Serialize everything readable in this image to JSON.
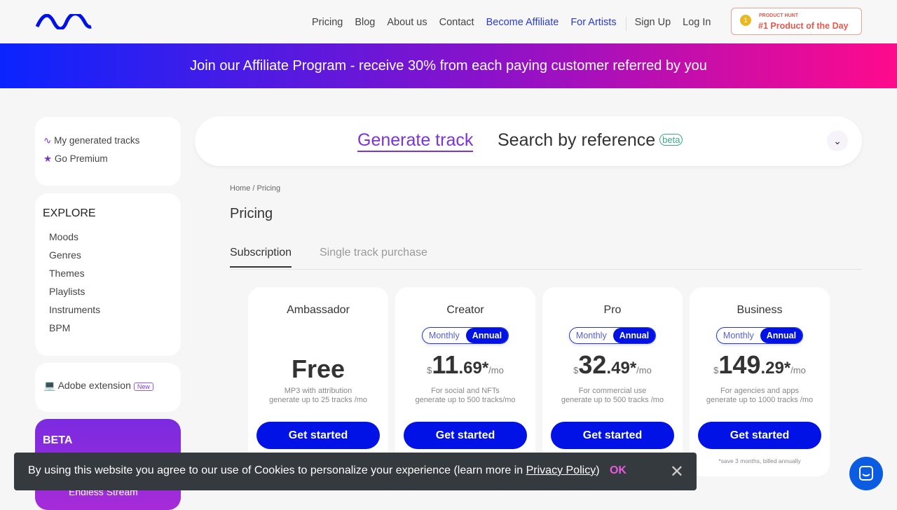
{
  "nav": {
    "items": [
      "Pricing",
      "Blog",
      "About us",
      "Contact",
      "Become Affiliate",
      "For Artists"
    ],
    "signup": "Sign Up",
    "login": "Log In",
    "producthunt": {
      "label": "PRODUCT HUNT",
      "title": "#1 Product of the Day",
      "medal": "1"
    }
  },
  "banner": "Join our Affiliate Program - receive 30% from each paying customer referred by you",
  "sidebar": {
    "quick": [
      "My generated tracks",
      "Go Premium"
    ],
    "explore_title": "EXPLORE",
    "explore": [
      "Moods",
      "Genres",
      "Themes",
      "Playlists",
      "Instruments",
      "BPM"
    ],
    "adobe": "Adobe extension",
    "new_badge": "New",
    "beta_title": "BETA",
    "endless": "Endless Stream"
  },
  "search": {
    "generate": "Generate track",
    "reference": "Search by reference",
    "beta": "beta"
  },
  "breadcrumb": {
    "home": "Home",
    "sep": "/",
    "current": "Pricing"
  },
  "title": "Pricing",
  "tabs": [
    "Subscription",
    "Single track purchase"
  ],
  "toggle": {
    "monthly": "Monthly",
    "annual": "Annual"
  },
  "plans": [
    {
      "name": "Ambassador",
      "price": "Free",
      "desc1": "MP3 with attribution",
      "desc2": "generate up to 25 tracks /mo",
      "cta": "Get started"
    },
    {
      "name": "Creator",
      "cur": "$",
      "int": "11",
      "cents": ".69*",
      "per": "/mo",
      "desc1": "For social and NFTs",
      "desc2": "generate up to 500 tracks/mo",
      "cta": "Get started"
    },
    {
      "name": "Pro",
      "cur": "$",
      "int": "32",
      "cents": ".49*",
      "per": "/mo",
      "desc1": "For commercial use",
      "desc2": "generate up to 500 tracks /mo",
      "cta": "Get started"
    },
    {
      "name": "Business",
      "cur": "$",
      "int": "149",
      "cents": ".29*",
      "per": "/mo",
      "desc1": "For agencies and apps",
      "desc2": "generate up to 1000 tracks /mo",
      "cta": "Get started",
      "note": "*save 3 months, billed annually"
    }
  ],
  "cookie": {
    "text": "By using this website you agree to our use of Cookies to personalize your experience (learn more in ",
    "link": "Privacy Policy",
    "close_paren": ")",
    "ok": "OK"
  }
}
